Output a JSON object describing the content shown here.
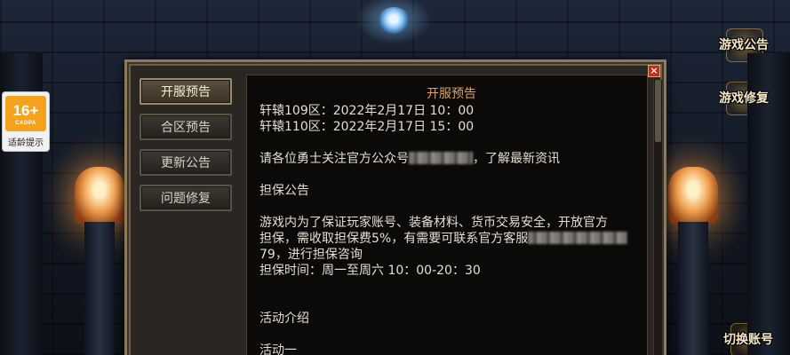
{
  "age_badge": {
    "rating": "16+",
    "org": "CADPA",
    "label": "适龄提示"
  },
  "side_buttons": {
    "announcement": "游戏公告",
    "repair": "游戏修复",
    "switch_account": "切换账号"
  },
  "panel": {
    "close_label": "×",
    "tabs": [
      {
        "label": "开服预告",
        "active": true
      },
      {
        "label": "合区预告",
        "active": false
      },
      {
        "label": "更新公告",
        "active": false
      },
      {
        "label": "问题修复",
        "active": false
      }
    ],
    "title": "开服预告",
    "lines": {
      "server_109": "轩辕109区：2022年2月17日 10：00",
      "server_110": "轩辕110区：2022年2月17日 15：00",
      "follow_prefix": "请各位勇士关注官方公众号",
      "follow_suffix": "，了解最新资讯",
      "guarantee_heading": "担保公告",
      "guarantee_1": "游戏内为了保证玩家账号、装备材料、货币交易安全，开放官方",
      "guarantee_2_prefix": "担保，需收取担保费5%，有需要可联系官方客服",
      "guarantee_3": "79，进行担保咨询",
      "guarantee_time": "担保时间：周一至周六 10：00-20：30",
      "activity_heading": "活动介绍",
      "activity_1": "活动一"
    }
  }
}
